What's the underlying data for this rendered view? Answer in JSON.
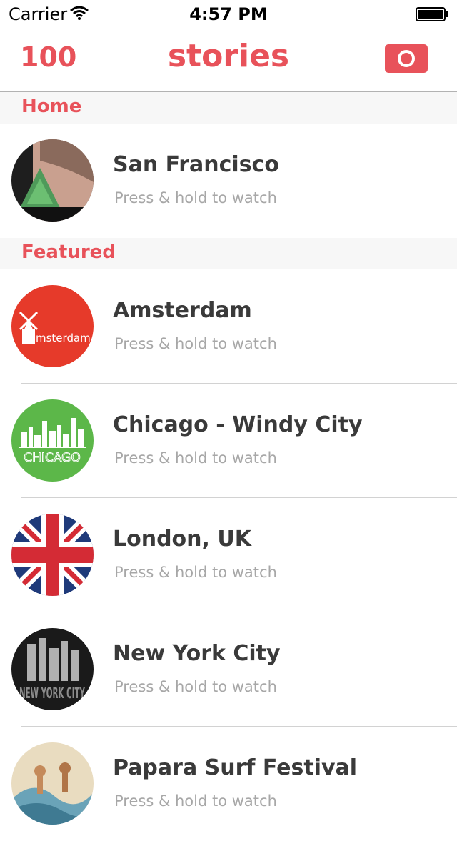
{
  "status": {
    "carrier": "Carrier",
    "time": "4:57 PM"
  },
  "nav": {
    "count": "100",
    "title": "stories"
  },
  "sections": {
    "home": "Home",
    "featured": "Featured"
  },
  "stories": [
    {
      "title": "San Francisco",
      "subtitle": "Press & hold to watch"
    },
    {
      "title": "Amsterdam",
      "subtitle": "Press & hold to watch",
      "badge_text": "msterdam"
    },
    {
      "title": "Chicago - Windy City",
      "subtitle": "Press & hold to watch",
      "badge_text": "CHICAGO"
    },
    {
      "title": "London, UK",
      "subtitle": "Press & hold to watch"
    },
    {
      "title": "New York City",
      "subtitle": "Press & hold to watch",
      "badge_text": "NEW YORK CITY"
    },
    {
      "title": "Papara Surf Festival",
      "subtitle": "Press & hold to watch"
    }
  ],
  "colors": {
    "accent": "#e8525a",
    "chicago_green": "#5cb749",
    "amsterdam_red": "#e63a2a"
  }
}
